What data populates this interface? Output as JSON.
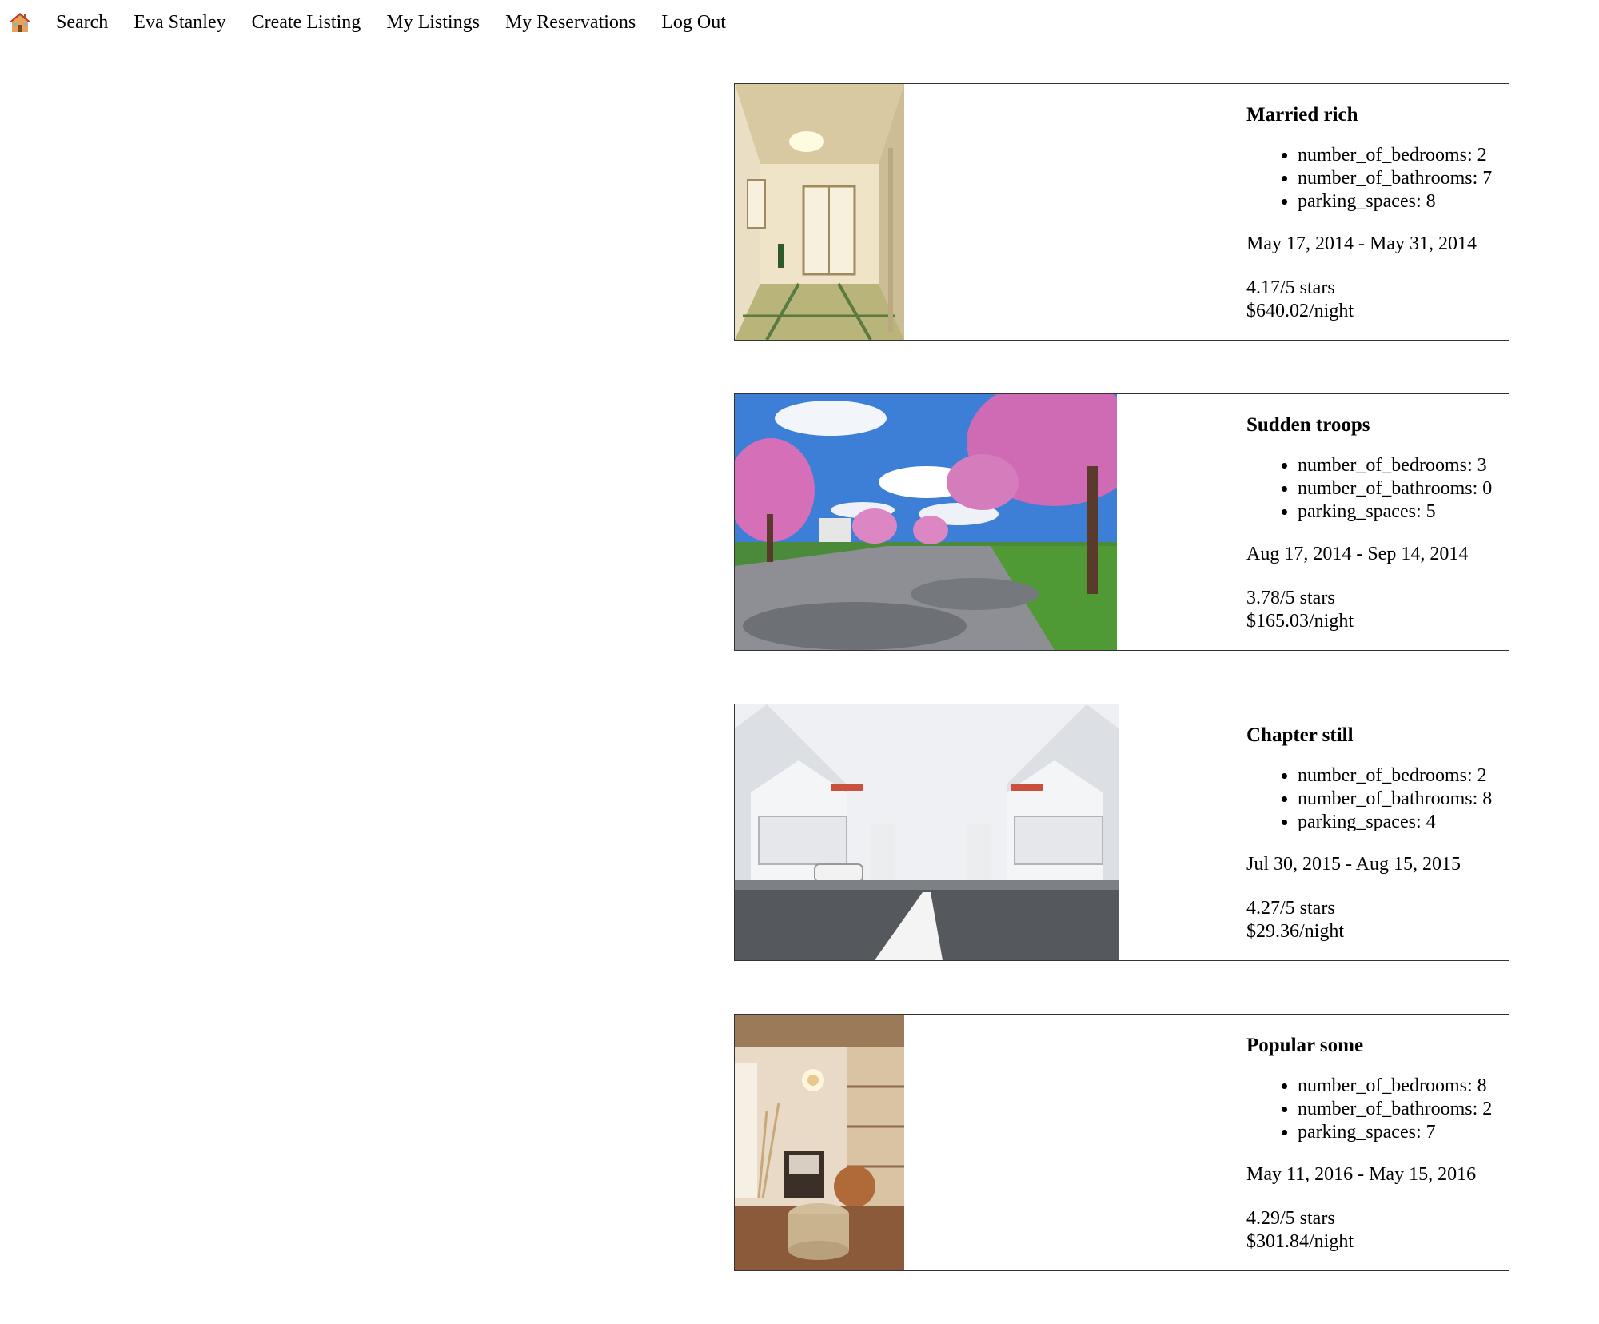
{
  "nav": {
    "home_icon": "house-emoji-icon",
    "items": [
      {
        "label": "Search"
      },
      {
        "label": "Eva Stanley"
      },
      {
        "label": "Create Listing"
      },
      {
        "label": "My Listings"
      },
      {
        "label": "My Reservations"
      },
      {
        "label": "Log Out"
      }
    ]
  },
  "listings": [
    {
      "title": "Married rich",
      "features": [
        "number_of_bedrooms: 2",
        "number_of_bathrooms: 7",
        "parking_spaces: 8"
      ],
      "dates": "May 17, 2014 - May 31, 2014",
      "stars": "4.17/5 stars",
      "price": "$640.02/night",
      "image": "japanese-tatami-room-photo"
    },
    {
      "title": "Sudden troops",
      "features": [
        "number_of_bedrooms: 3",
        "number_of_bathrooms: 0",
        "parking_spaces: 5"
      ],
      "dates": "Aug 17, 2014 - Sep 14, 2014",
      "stars": "3.78/5 stars",
      "price": "$165.03/night",
      "image": "cherry-blossom-street-photo"
    },
    {
      "title": "Chapter still",
      "features": [
        "number_of_bedrooms: 2",
        "number_of_bathrooms: 8",
        "parking_spaces: 4"
      ],
      "dates": "Jul 30, 2015 - Aug 15, 2015",
      "stars": "4.27/5 stars",
      "price": "$29.36/night",
      "image": "white-houses-street-photo"
    },
    {
      "title": "Popular some",
      "features": [
        "number_of_bedrooms: 8",
        "number_of_bathrooms: 2",
        "parking_spaces: 7"
      ],
      "dates": "May 11, 2016 - May 15, 2016",
      "stars": "4.29/5 stars",
      "price": "$301.84/night",
      "image": "cozy-living-room-photo"
    }
  ]
}
